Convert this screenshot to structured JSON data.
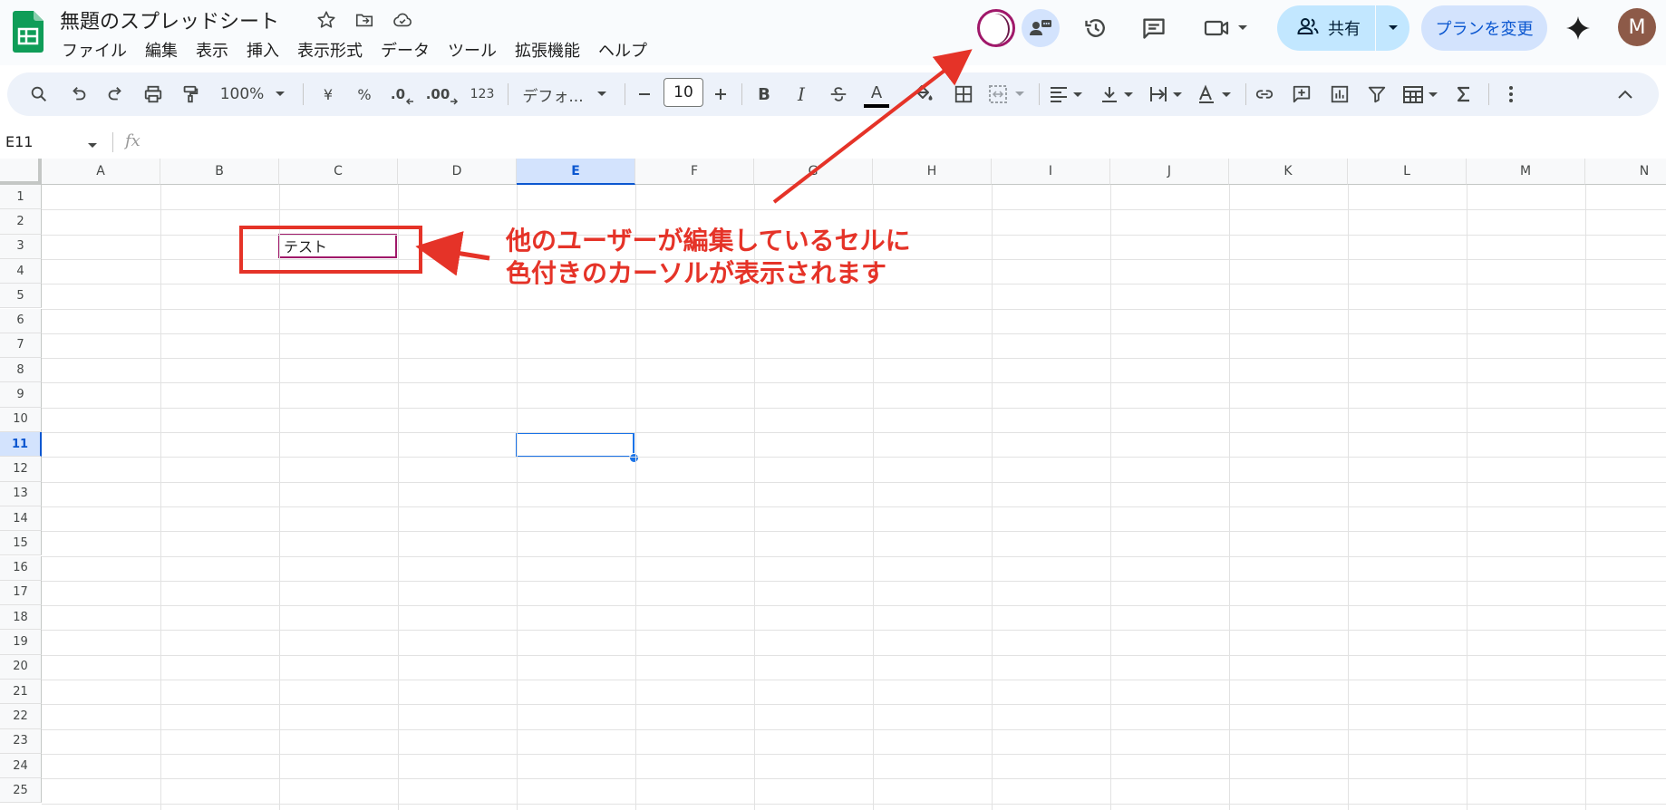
{
  "app": {
    "document_title": "無題のスプレッドシート"
  },
  "menu": [
    "ファイル",
    "編集",
    "表示",
    "挿入",
    "表示形式",
    "データ",
    "ツール",
    "拡張機能",
    "ヘルプ"
  ],
  "header": {
    "share_label": "共有",
    "plan_label": "プランを変更",
    "avatar_initial": "M"
  },
  "toolbar": {
    "zoom": "100%",
    "currency": "¥",
    "percent": "%",
    "decimal_decrease": ".0",
    "decimal_increase": ".00",
    "number_format": "123",
    "font_family": "デフォ...",
    "font_size": "10",
    "bold": "B",
    "italic": "I",
    "text_color": "A"
  },
  "formula_bar": {
    "cell_ref": "E11",
    "fx": "fx",
    "value": ""
  },
  "sheet": {
    "columns": [
      "A",
      "B",
      "C",
      "D",
      "E",
      "F",
      "G",
      "H",
      "I",
      "J",
      "K",
      "L",
      "M",
      "N"
    ],
    "rows": [
      "1",
      "2",
      "3",
      "4",
      "5",
      "6",
      "7",
      "8",
      "9",
      "10",
      "11",
      "12",
      "13",
      "14",
      "15",
      "16",
      "17",
      "18",
      "19",
      "20",
      "21",
      "22",
      "23",
      "24",
      "25"
    ],
    "selected_column": "E",
    "selected_row": "11",
    "cells": {
      "C3": "テスト"
    }
  },
  "annotation": {
    "line1": "他のユーザーが編集しているセルに",
    "line2": "色付きのカーソルが表示されます",
    "color": "#e53328"
  },
  "colors": {
    "peer_cursor": "#a0186a",
    "active_cell": "#1a73e8",
    "share_bg": "#c2e7ff",
    "plan_bg": "#d3e3fd",
    "sheets_green": "#0f9d58"
  }
}
